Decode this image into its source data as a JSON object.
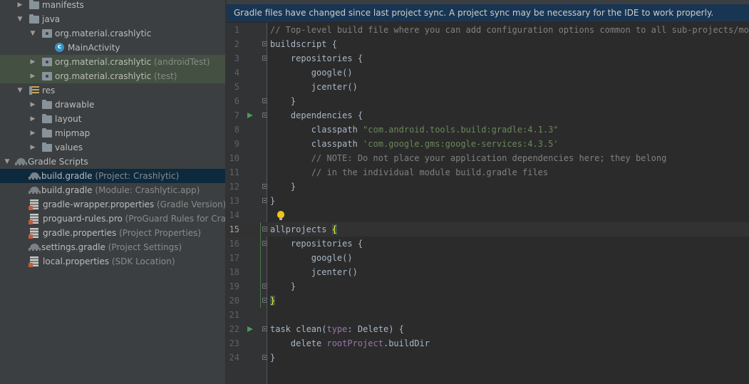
{
  "project_tree": {
    "rows": [
      {
        "label": "manifests",
        "sub": "",
        "icon": "folder-icon",
        "arrow": "right"
      },
      {
        "label": "java",
        "sub": "",
        "icon": "folder-icon",
        "arrow": "down"
      },
      {
        "label": "org.material.crashlytic",
        "sub": "",
        "icon": "package-icon",
        "arrow": "down"
      },
      {
        "label": "MainActivity",
        "sub": "",
        "icon": "class-icon",
        "arrow": "none"
      },
      {
        "label": "org.material.crashlytic",
        "sub": "(androidTest)",
        "icon": "package-icon",
        "arrow": "right"
      },
      {
        "label": "org.material.crashlytic",
        "sub": "(test)",
        "icon": "package-icon",
        "arrow": "right"
      },
      {
        "label": "res",
        "sub": "",
        "icon": "resources-folder-icon",
        "arrow": "down"
      },
      {
        "label": "drawable",
        "sub": "",
        "icon": "folder-icon",
        "arrow": "right"
      },
      {
        "label": "layout",
        "sub": "",
        "icon": "folder-icon",
        "arrow": "right"
      },
      {
        "label": "mipmap",
        "sub": "",
        "icon": "folder-icon",
        "arrow": "right"
      },
      {
        "label": "values",
        "sub": "",
        "icon": "folder-icon",
        "arrow": "right"
      },
      {
        "label": "Gradle Scripts",
        "sub": "",
        "icon": "gradle-icon",
        "arrow": "down"
      },
      {
        "label": "build.gradle",
        "sub": "(Project: Crashlytic)",
        "icon": "gradle-icon",
        "arrow": "none"
      },
      {
        "label": "build.gradle",
        "sub": "(Module: Crashlytic.app)",
        "icon": "gradle-icon",
        "arrow": "none"
      },
      {
        "label": "gradle-wrapper.properties",
        "sub": "(Gradle Version)",
        "icon": "properties-icon",
        "arrow": "none"
      },
      {
        "label": "proguard-rules.pro",
        "sub": "(ProGuard Rules for Crashlytic)",
        "icon": "properties-icon",
        "arrow": "none"
      },
      {
        "label": "gradle.properties",
        "sub": "(Project Properties)",
        "icon": "properties-icon",
        "arrow": "none"
      },
      {
        "label": "settings.gradle",
        "sub": "(Project Settings)",
        "icon": "gradle-icon",
        "arrow": "none"
      },
      {
        "label": "local.properties",
        "sub": "(SDK Location)",
        "icon": "properties-icon",
        "arrow": "none"
      }
    ]
  },
  "banner": {
    "text": "Gradle files have changed since last project sync. A project sync may be necessary for the IDE to work properly."
  },
  "editor": {
    "current_line": 15,
    "lines": [
      {
        "n": "1",
        "tokens": [
          {
            "t": "// Top-level build file where you can add configuration options common to all sub-projects/modul",
            "c": "com"
          }
        ]
      },
      {
        "n": "2",
        "tokens": [
          {
            "t": "buildscript {",
            "c": ""
          }
        ]
      },
      {
        "n": "3",
        "tokens": [
          {
            "t": "    repositories {",
            "c": ""
          }
        ]
      },
      {
        "n": "4",
        "tokens": [
          {
            "t": "        google()",
            "c": ""
          }
        ]
      },
      {
        "n": "5",
        "tokens": [
          {
            "t": "        jcenter()",
            "c": ""
          }
        ]
      },
      {
        "n": "6",
        "tokens": [
          {
            "t": "    }",
            "c": ""
          }
        ]
      },
      {
        "n": "7",
        "tokens": [
          {
            "t": "    dependencies {",
            "c": ""
          }
        ]
      },
      {
        "n": "8",
        "tokens": [
          {
            "t": "        classpath ",
            "c": ""
          },
          {
            "t": "\"com.android.tools.build:gradle:4.1.3\"",
            "c": "str"
          }
        ]
      },
      {
        "n": "9",
        "tokens": [
          {
            "t": "        classpath ",
            "c": ""
          },
          {
            "t": "'com.google.gms:google-services:4.3.5'",
            "c": "str"
          }
        ]
      },
      {
        "n": "10",
        "tokens": [
          {
            "t": "        // NOTE: Do not place your application dependencies here; they belong",
            "c": "com"
          }
        ]
      },
      {
        "n": "11",
        "tokens": [
          {
            "t": "        // in the individual module build.gradle files",
            "c": "com"
          }
        ]
      },
      {
        "n": "12",
        "tokens": [
          {
            "t": "    }",
            "c": ""
          }
        ]
      },
      {
        "n": "13",
        "tokens": [
          {
            "t": "}",
            "c": ""
          }
        ]
      },
      {
        "n": "14",
        "tokens": []
      },
      {
        "n": "15",
        "tokens": [
          {
            "t": "allprojects ",
            "c": ""
          },
          {
            "t": "{",
            "c": "brace"
          }
        ]
      },
      {
        "n": "16",
        "tokens": [
          {
            "t": "    repositories {",
            "c": ""
          }
        ]
      },
      {
        "n": "17",
        "tokens": [
          {
            "t": "        google()",
            "c": ""
          }
        ]
      },
      {
        "n": "18",
        "tokens": [
          {
            "t": "        jcenter()",
            "c": ""
          }
        ]
      },
      {
        "n": "19",
        "tokens": [
          {
            "t": "    }",
            "c": ""
          }
        ]
      },
      {
        "n": "20",
        "tokens": [
          {
            "t": "}",
            "c": "brace"
          }
        ]
      },
      {
        "n": "21",
        "tokens": []
      },
      {
        "n": "22",
        "tokens": [
          {
            "t": "task clean(",
            "c": ""
          },
          {
            "t": "type",
            "c": "named"
          },
          {
            "t": ": Delete) {",
            "c": ""
          }
        ]
      },
      {
        "n": "23",
        "tokens": [
          {
            "t": "    delete ",
            "c": ""
          },
          {
            "t": "rootProject",
            "c": "named"
          },
          {
            "t": ".buildDir",
            "c": ""
          }
        ]
      },
      {
        "n": "24",
        "tokens": [
          {
            "t": "}",
            "c": ""
          }
        ]
      }
    ]
  }
}
